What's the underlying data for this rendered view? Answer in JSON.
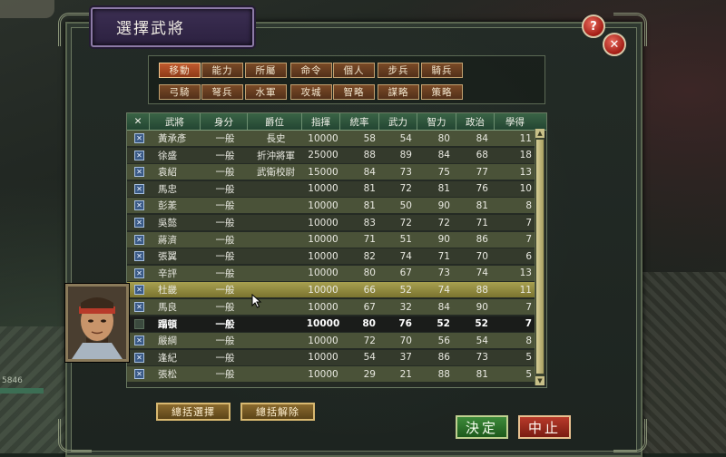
{
  "side_status": "5846",
  "window": {
    "title": "選擇武將",
    "help_label": "?",
    "close_label": "✕"
  },
  "filters": {
    "row1": [
      "移動",
      "能力",
      "所屬",
      "命令",
      "個人",
      "步兵",
      "騎兵"
    ],
    "row2": [
      "弓騎",
      "弩兵",
      "水軍",
      "攻城",
      "智略",
      "謀略",
      "策略"
    ],
    "active": "移動"
  },
  "table": {
    "headers": [
      "✕",
      "武將",
      "身分",
      "爵位",
      "指揮",
      "統率",
      "武力",
      "智力",
      "政治",
      "學得"
    ],
    "rows": [
      {
        "checked": true,
        "name": "黃承彥",
        "rank": "一般",
        "title": "長史",
        "command": "10000",
        "lead": "58",
        "war": "54",
        "int": "80",
        "pol": "84",
        "learn": "11"
      },
      {
        "checked": true,
        "name": "徐盛",
        "rank": "一般",
        "title": "折沖將軍",
        "command": "25000",
        "lead": "88",
        "war": "89",
        "int": "84",
        "pol": "68",
        "learn": "18"
      },
      {
        "checked": true,
        "name": "袁紹",
        "rank": "一般",
        "title": "武衛校尉",
        "command": "15000",
        "lead": "84",
        "war": "73",
        "int": "75",
        "pol": "77",
        "learn": "13"
      },
      {
        "checked": true,
        "name": "馬忠",
        "rank": "一般",
        "title": "",
        "command": "10000",
        "lead": "81",
        "war": "72",
        "int": "81",
        "pol": "76",
        "learn": "10"
      },
      {
        "checked": true,
        "name": "彭羕",
        "rank": "一般",
        "title": "",
        "command": "10000",
        "lead": "81",
        "war": "50",
        "int": "90",
        "pol": "81",
        "learn": "8"
      },
      {
        "checked": true,
        "name": "吳懿",
        "rank": "一般",
        "title": "",
        "command": "10000",
        "lead": "83",
        "war": "72",
        "int": "72",
        "pol": "71",
        "learn": "7"
      },
      {
        "checked": true,
        "name": "蔣濟",
        "rank": "一般",
        "title": "",
        "command": "10000",
        "lead": "71",
        "war": "51",
        "int": "90",
        "pol": "86",
        "learn": "7"
      },
      {
        "checked": true,
        "name": "張翼",
        "rank": "一般",
        "title": "",
        "command": "10000",
        "lead": "82",
        "war": "74",
        "int": "71",
        "pol": "70",
        "learn": "6"
      },
      {
        "checked": true,
        "name": "辛評",
        "rank": "一般",
        "title": "",
        "command": "10000",
        "lead": "80",
        "war": "67",
        "int": "73",
        "pol": "74",
        "learn": "13"
      },
      {
        "checked": true,
        "name": "杜畿",
        "rank": "一般",
        "title": "",
        "command": "10000",
        "lead": "66",
        "war": "52",
        "int": "74",
        "pol": "88",
        "learn": "11"
      },
      {
        "checked": true,
        "name": "馬良",
        "rank": "一般",
        "title": "",
        "command": "10000",
        "lead": "67",
        "war": "32",
        "int": "84",
        "pol": "90",
        "learn": "7"
      },
      {
        "checked": false,
        "name": "蹋頓",
        "rank": "一般",
        "title": "",
        "command": "10000",
        "lead": "80",
        "war": "76",
        "int": "52",
        "pol": "52",
        "learn": "7"
      },
      {
        "checked": true,
        "name": "嚴綱",
        "rank": "一般",
        "title": "",
        "command": "10000",
        "lead": "72",
        "war": "70",
        "int": "56",
        "pol": "54",
        "learn": "8"
      },
      {
        "checked": true,
        "name": "逢紀",
        "rank": "一般",
        "title": "",
        "command": "10000",
        "lead": "54",
        "war": "37",
        "int": "86",
        "pol": "73",
        "learn": "5"
      },
      {
        "checked": true,
        "name": "張松",
        "rank": "一般",
        "title": "",
        "command": "10000",
        "lead": "29",
        "war": "21",
        "int": "88",
        "pol": "81",
        "learn": "5"
      }
    ],
    "selected_index": 9,
    "dark_index": 11
  },
  "buttons": {
    "select_all": "總括選擇",
    "deselect_all": "總括解除",
    "ok": "決定",
    "cancel": "中止"
  },
  "colors": {
    "accent_gold": "#d8b870",
    "ok_green": "#2e7a2c",
    "cancel_red": "#a8301e",
    "title_purple": "#3b2e52",
    "header_green": "#2e5a3c"
  }
}
